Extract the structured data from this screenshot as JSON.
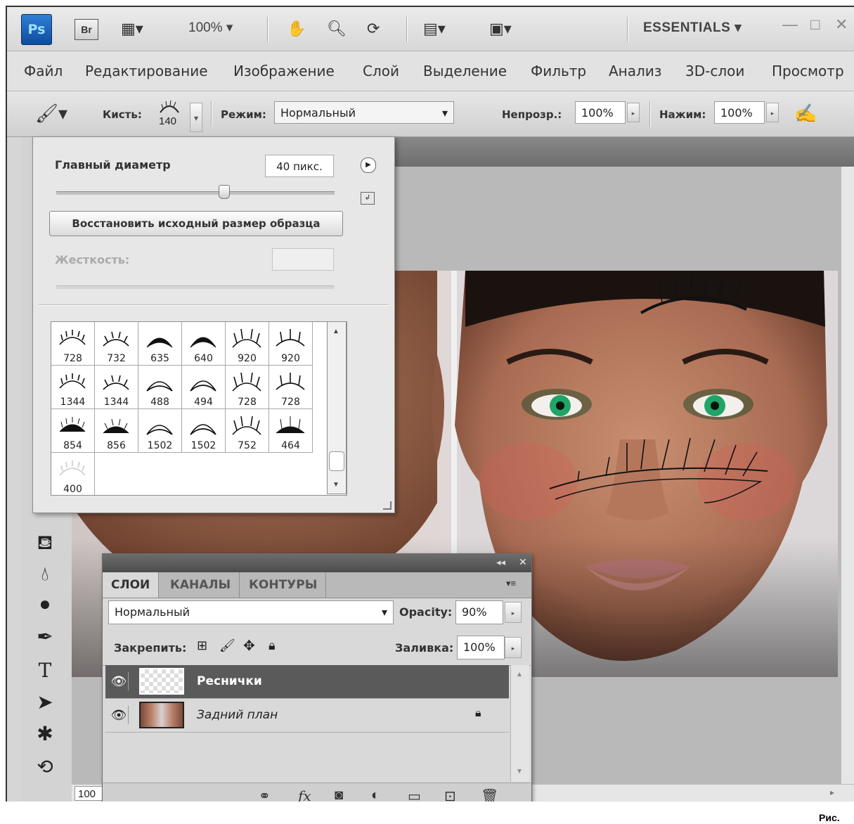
{
  "app": {
    "logo": "Ps",
    "bridge": "Br",
    "zoom": "100%",
    "workspace": "ESSENTIALS",
    "window_controls": [
      "minimize-icon",
      "maximize-icon",
      "close-icon"
    ]
  },
  "menu": [
    "Файл",
    "Редактирование",
    "Изображение",
    "Слой",
    "Выделение",
    "Фильтр",
    "Анализ",
    "3D-слои",
    "Просмотр"
  ],
  "options": {
    "brush_label": "Кисть:",
    "brush_size": "140",
    "mode_label": "Режим:",
    "mode_value": "Нормальный",
    "opacity_label": "Непрозр.:",
    "opacity_value": "100%",
    "flow_label": "Нажим:",
    "flow_value": "100%"
  },
  "brush_picker": {
    "diameter_label": "Главный диаметр",
    "diameter_value": "40 пикс.",
    "diameter_slider": 0.6,
    "reset_button": "Восстановить исходный размер образца",
    "hardness_label": "Жесткость:",
    "brushes": [
      "728",
      "732",
      "635",
      "640",
      "920",
      "920",
      "1344",
      "1344",
      "488",
      "494",
      "728",
      "728",
      "854",
      "856",
      "1502",
      "1502",
      "752",
      "464",
      "400"
    ]
  },
  "status": {
    "zoom": "100"
  },
  "layers_panel": {
    "tabs": [
      "СЛОИ",
      "КАНАЛЫ",
      "КОНТУРЫ"
    ],
    "blend_mode": "Нормальный",
    "opacity_label": "Opacity:",
    "opacity_value": "90%",
    "lock_label": "Закрепить:",
    "fill_label": "Заливка:",
    "fill_value": "100%",
    "layers": [
      {
        "name": "Реснички",
        "selected": true
      },
      {
        "name": "Задний план",
        "selected": false,
        "locked": true
      }
    ]
  },
  "caption": "Рис."
}
